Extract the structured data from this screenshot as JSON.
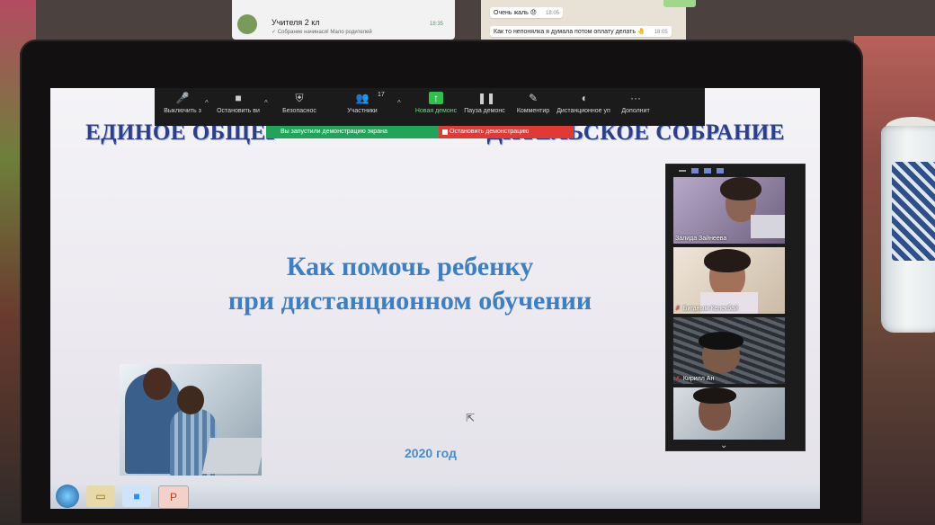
{
  "phone": {
    "chat_name": "Учителя 2 кл",
    "chat_preview": "✓ Собрание начинася! Мало родителей",
    "chat_time": "18:35",
    "messages": [
      {
        "text": "Очень жаль 😞",
        "time": "18:05"
      },
      {
        "text": "Как то непонялка я думала потом оплату делать 🤚",
        "time": "18:05"
      }
    ]
  },
  "zoom_toolbar": {
    "items": [
      {
        "label": "Выключить з",
        "icon": "microphone-icon"
      },
      {
        "label": "Остановить ви",
        "icon": "video-camera-icon"
      },
      {
        "label": "Безопаснос",
        "icon": "shield-icon"
      },
      {
        "label": "Участники",
        "icon": "participants-icon"
      },
      {
        "label": "Новая демонс",
        "icon": "share-screen-icon"
      },
      {
        "label": "Пауза демонс",
        "icon": "pause-icon"
      },
      {
        "label": "Комментир",
        "icon": "pencil-icon"
      },
      {
        "label": "Дистанционное уп",
        "icon": "mouse-icon"
      },
      {
        "label": "Дополнит",
        "icon": "more-icon"
      }
    ],
    "participants_count": "17",
    "share_notice": "Вы запустили демонстрацию экрана",
    "stop_share": "Остановить демонстрацию"
  },
  "slide": {
    "heading_left": "ЕДИНОЕ ОБЩЕР",
    "heading_right": "ДИТЕЛЬСКОЕ СОБРАНИЕ",
    "title_line1": "Как помочь ребенку",
    "title_line2": "при дистанционном обучении",
    "year": "2020 год"
  },
  "participants": [
    {
      "name": "Залида Зайнеева",
      "muted": false
    },
    {
      "name": "Биганым Кенекбай",
      "muted": true
    },
    {
      "name": "Кирилл Ан",
      "muted": true
    },
    {
      "name": "",
      "muted": false
    }
  ],
  "taskbar": {
    "apps": [
      "start-icon",
      "explorer-icon",
      "zoom-icon",
      "powerpoint-icon"
    ]
  },
  "colors": {
    "heading": "#2d3f86",
    "title": "#3c7fc4",
    "share_green": "#21a45a",
    "stop_red": "#e03a37"
  }
}
